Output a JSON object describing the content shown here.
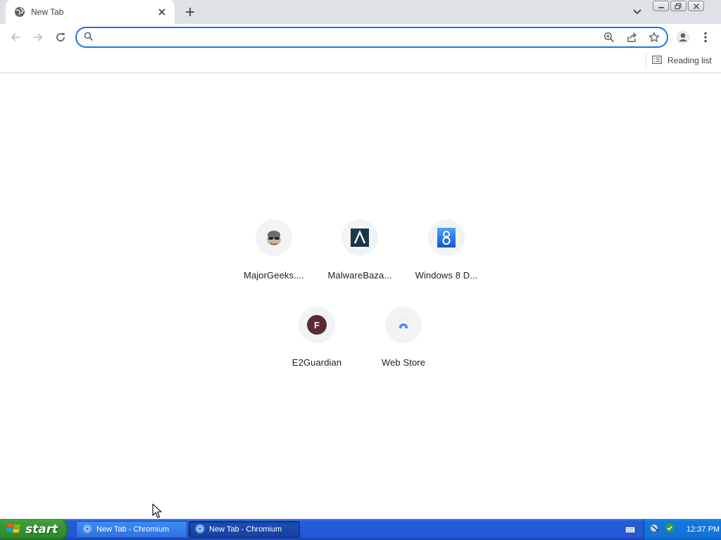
{
  "browser": {
    "tab": {
      "title": "New Tab",
      "favicon": "globe-icon"
    },
    "omnibox": {
      "value": "",
      "placeholder": ""
    },
    "reading_list_label": "Reading list"
  },
  "shortcuts": [
    {
      "label": "MajorGeeks....",
      "icon": "majorgeeks-icon"
    },
    {
      "label": "MalwareBaza...",
      "icon": "malwarebazaar-icon"
    },
    {
      "label": "Windows 8 D...",
      "icon": "windows8-icon"
    },
    {
      "label": "E2Guardian",
      "icon": "e2guardian-icon",
      "letter": "F"
    },
    {
      "label": "Web Store",
      "icon": "webstore-icon"
    }
  ],
  "taskbar": {
    "start_label": "start",
    "windows": [
      {
        "label": "New Tab - Chromium",
        "active": false
      },
      {
        "label": "New Tab - Chromium",
        "active": true
      }
    ],
    "clock": "12:37 PM"
  },
  "colors": {
    "accent": "#1a73e8",
    "tabstrip": "#dee1e6",
    "taskbar": "#245edb",
    "start_button": "#3c9a39"
  }
}
